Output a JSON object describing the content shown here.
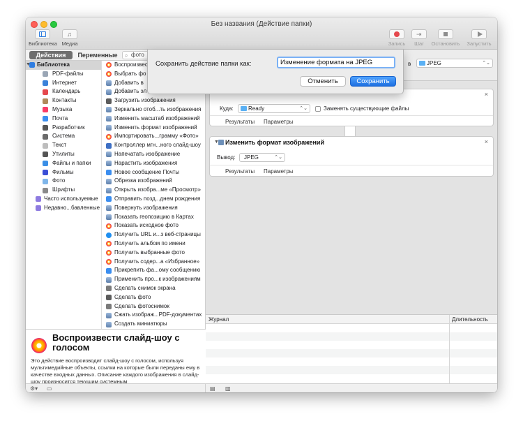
{
  "window": {
    "title": "Без названия (Действие папки)"
  },
  "toolbar": {
    "library": "Библиотека",
    "media": "Медиа",
    "record": "Запись",
    "step": "Шаг",
    "stop": "Остановить",
    "run": "Запустить"
  },
  "library": {
    "tab_actions": "Действия",
    "tab_variables": "Переменные",
    "search_value": "фото"
  },
  "categories": [
    {
      "label": "Библиотека",
      "icon": "library-folder-icon",
      "color": "#2f7de1"
    },
    {
      "label": "PDF-файлы",
      "icon": "pdf-icon",
      "color": "#9aa6b5"
    },
    {
      "label": "Интернет",
      "icon": "globe-icon",
      "color": "#3b82d9"
    },
    {
      "label": "Календарь",
      "icon": "calendar-icon",
      "color": "#e5484d"
    },
    {
      "label": "Контакты",
      "icon": "contacts-icon",
      "color": "#b08a5a"
    },
    {
      "label": "Музыка",
      "icon": "music-icon",
      "color": "#fa3c66"
    },
    {
      "label": "Почта",
      "icon": "mail-icon",
      "color": "#3b8ef0"
    },
    {
      "label": "Разработчик",
      "icon": "hammer-icon",
      "color": "#555555"
    },
    {
      "label": "Система",
      "icon": "system-icon",
      "color": "#6b6b6b"
    },
    {
      "label": "Текст",
      "icon": "text-icon",
      "color": "#bdbdbd"
    },
    {
      "label": "Утилиты",
      "icon": "utilities-icon",
      "color": "#555555"
    },
    {
      "label": "Файлы и папки",
      "icon": "finder-icon",
      "color": "#3a8ee6"
    },
    {
      "label": "Фильмы",
      "icon": "movies-icon",
      "color": "#3a4ed6"
    },
    {
      "label": "Фото",
      "icon": "photos-icon",
      "color": "#7fb6ea"
    },
    {
      "label": "Шрифты",
      "icon": "fonts-icon",
      "color": "#8a8a8a"
    },
    {
      "label": "Часто используемые",
      "icon": "smart-folder-icon",
      "color": "#8e7be0"
    },
    {
      "label": "Недавно...бавленные",
      "icon": "smart-folder-icon",
      "color": "#8e7be0"
    }
  ],
  "actions": [
    {
      "label": "Воспроизвести",
      "icon": "photos-icon"
    },
    {
      "label": "Выбрать фо",
      "icon": "photos-icon"
    },
    {
      "label": "Добавить в",
      "icon": "preview-icon"
    },
    {
      "label": "Добавить эл",
      "icon": "preview-icon"
    },
    {
      "label": "Загрузить изображения",
      "icon": "camera-icon"
    },
    {
      "label": "Зеркально отоб...ть изображения",
      "icon": "preview-icon"
    },
    {
      "label": "Изменить масштаб изображений",
      "icon": "preview-icon"
    },
    {
      "label": "Изменить формат изображений",
      "icon": "preview-icon"
    },
    {
      "label": "Импортировать...грамму «Фото»",
      "icon": "photos-icon"
    },
    {
      "label": "Контроллер мгн...ного слайд-шоу",
      "icon": "slideshow-icon"
    },
    {
      "label": "Напечатать изображение",
      "icon": "preview-icon"
    },
    {
      "label": "Нарастить изображения",
      "icon": "preview-icon"
    },
    {
      "label": "Новое сообщение Почты",
      "icon": "mail-icon"
    },
    {
      "label": "Обрезка изображений",
      "icon": "preview-icon"
    },
    {
      "label": "Открыть изобра...ме «Просмотр»",
      "icon": "preview-icon"
    },
    {
      "label": "Отправить позд...днем рождения",
      "icon": "mail-icon"
    },
    {
      "label": "Повернуть изображения",
      "icon": "preview-icon"
    },
    {
      "label": "Показать геопозицию в Картах",
      "icon": "preview-icon"
    },
    {
      "label": "Показать исходное фото",
      "icon": "photos-icon"
    },
    {
      "label": "Получить URL и...з веб-страницы",
      "icon": "safari-icon"
    },
    {
      "label": "Получить альбом по имени",
      "icon": "photos-icon"
    },
    {
      "label": "Получить выбранные фото",
      "icon": "photos-icon"
    },
    {
      "label": "Получить содер...а «Избранное»",
      "icon": "photos-icon"
    },
    {
      "label": "Прикрепить фа...ому сообщению",
      "icon": "mail-icon"
    },
    {
      "label": "Применить про...к изображениям",
      "icon": "preview-icon"
    },
    {
      "label": "Сделать снимок экрана",
      "icon": "utilities-icon"
    },
    {
      "label": "Сделать фото",
      "icon": "camera-icon"
    },
    {
      "label": "Сделать фотоснимок",
      "icon": "utilities-icon"
    },
    {
      "label": "Сжать изображ...PDF-документах",
      "icon": "preview-icon"
    },
    {
      "label": "Создать миниатюры",
      "icon": "preview-icon"
    }
  ],
  "description": {
    "title": "Воспроизвести слайд-шоу с голосом",
    "text": "Это действие воспроизводит слайд-шоу с голосом, используя мультимедийные объекты, ссылки на которые были переданы ему в качестве входных данных. Описание каждого изображения в слайд-шоу произносится текущим системным"
  },
  "workflow": {
    "header_label": "в",
    "header_value": "JPEG",
    "card1": {
      "where_label": "Куда:",
      "where_value": "Ready",
      "replace_label": "Заменять существующие файлы",
      "tab_results": "Результаты",
      "tab_options": "Параметры"
    },
    "card2": {
      "title": "Изменить формат изображений",
      "output_label": "Вывод:",
      "output_value": "JPEG",
      "tab_results": "Результаты",
      "tab_options": "Параметры"
    }
  },
  "log": {
    "col_log": "Журнал",
    "col_duration": "Длительность"
  },
  "sheet": {
    "label": "Сохранить действие папки как:",
    "value": "Изменение формата на JPEG",
    "cancel": "Отменить",
    "save": "Сохранить"
  },
  "colors": {
    "accent": "#1d6fe0",
    "focus_ring": "#7ab1f5"
  }
}
